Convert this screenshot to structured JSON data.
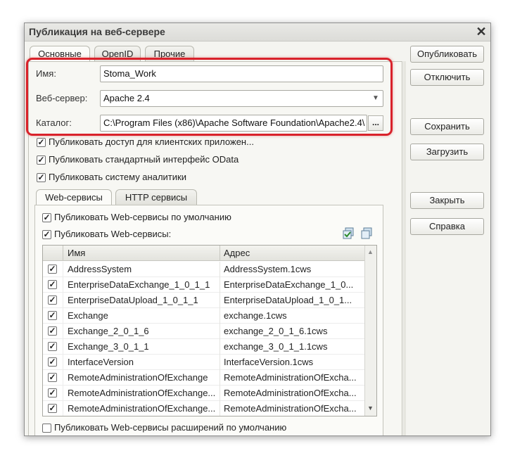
{
  "window": {
    "title": "Публикация на веб-сервере",
    "close_glyph": "✕"
  },
  "tabs": [
    {
      "label": "Основные",
      "active": true
    },
    {
      "label": "OpenID",
      "active": false
    },
    {
      "label": "Прочие",
      "active": false
    }
  ],
  "form": {
    "name_label": "Имя:",
    "name_value": "Stoma_Work",
    "server_label": "Веб-сервер:",
    "server_value": "Apache 2.4",
    "catalog_label": "Каталог:",
    "catalog_value": "C:\\Program Files (x86)\\Apache Software Foundation\\Apache2.4\\",
    "browse_label": "..."
  },
  "options": {
    "client_apps": {
      "label": "Публиковать доступ для клиентских приложен...",
      "checked": true
    },
    "odata": {
      "label": "Публиковать стандартный интерфейс OData",
      "checked": true
    },
    "analytics": {
      "label": "Публиковать систему аналитики",
      "checked": true
    }
  },
  "subtabs": [
    {
      "label": "Web-сервисы",
      "active": true
    },
    {
      "label": "HTTP сервисы",
      "active": false
    }
  ],
  "web_services": {
    "default_label": "Публиковать Web-сервисы по умолчанию",
    "default_checked": true,
    "publish_label": "Публиковать Web-сервисы:",
    "publish_checked": true,
    "extensions_label": "Публиковать Web-сервисы расширений по умолчанию",
    "extensions_checked": false,
    "columns": {
      "name": "Имя",
      "address": "Адрес"
    },
    "rows": [
      {
        "checked": true,
        "name": "AddressSystem",
        "address": "AddressSystem.1cws"
      },
      {
        "checked": true,
        "name": "EnterpriseDataExchange_1_0_1_1",
        "address": "EnterpriseDataExchange_1_0..."
      },
      {
        "checked": true,
        "name": "EnterpriseDataUpload_1_0_1_1",
        "address": "EnterpriseDataUpload_1_0_1..."
      },
      {
        "checked": true,
        "name": "Exchange",
        "address": "exchange.1cws"
      },
      {
        "checked": true,
        "name": "Exchange_2_0_1_6",
        "address": "exchange_2_0_1_6.1cws"
      },
      {
        "checked": true,
        "name": "Exchange_3_0_1_1",
        "address": "exchange_3_0_1_1.1cws"
      },
      {
        "checked": true,
        "name": "InterfaceVersion",
        "address": "InterfaceVersion.1cws"
      },
      {
        "checked": true,
        "name": "RemoteAdministrationOfExchange",
        "address": "RemoteAdministrationOfExcha..."
      },
      {
        "checked": true,
        "name": "RemoteAdministrationOfExchange...",
        "address": "RemoteAdministrationOfExcha..."
      },
      {
        "checked": true,
        "name": "RemoteAdministrationOfExchange...",
        "address": "RemoteAdministrationOfExcha..."
      }
    ]
  },
  "buttons": {
    "publish": "Опубликовать",
    "disable": "Отключить",
    "save": "Сохранить",
    "load": "Загрузить",
    "close": "Закрыть",
    "help": "Справка"
  },
  "colors": {
    "highlight": "#d9222b",
    "window_bg": "#f4f4f0"
  }
}
